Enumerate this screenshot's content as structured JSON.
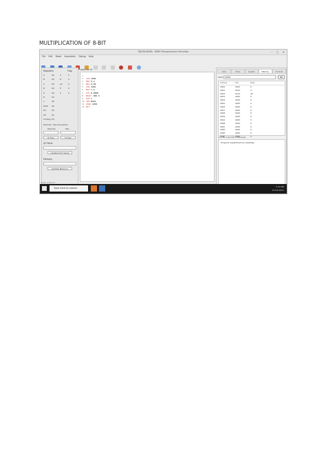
{
  "document": {
    "title": "MULTIPLICATION OF 8-BIT"
  },
  "window": {
    "title": "GNUSim8085 - 8085 Microprocessor Simulator"
  },
  "menu": [
    "File",
    "Edit",
    "Reset",
    "Assembler",
    "Debug",
    "Help"
  ],
  "registers": {
    "header_left": "Registers",
    "header_right": "Flag",
    "rows": [
      [
        "A",
        "00",
        "S",
        "0"
      ],
      [
        "B",
        "00",
        "Z",
        "0"
      ],
      [
        "C",
        "00",
        "AC",
        "0"
      ],
      [
        "D",
        "00",
        "P",
        "0"
      ],
      [
        "E",
        "00",
        "C",
        "0"
      ],
      [
        "H",
        "00",
        "",
        ""
      ],
      [
        "L",
        "00",
        "",
        ""
      ],
      [
        "PSW",
        "00",
        "",
        ""
      ],
      [
        "PC",
        "00",
        "",
        ""
      ],
      [
        "SP",
        "00",
        "",
        ""
      ],
      [
        "Int-Reg",
        "00",
        "",
        ""
      ]
    ]
  },
  "io_panel": {
    "header": "I/O Ports",
    "button": "Update Port Value"
  },
  "memory_panel": {
    "header": "Memory",
    "button": "Update Memory"
  },
  "decimal_panel": {
    "header": "Decimal - Hex Convertion",
    "left": "Decimal",
    "right": "Hex",
    "btn_left": "To Hex",
    "btn_right": "To Dec"
  },
  "editor": {
    "label": "Load me at",
    "lines": [
      {
        "n": "1",
        "op": "",
        "text": ""
      },
      {
        "n": "2",
        "op": "LDA",
        "text": " 2200"
      },
      {
        "n": "3",
        "op": "MOV",
        "text": " E,A"
      },
      {
        "n": "4",
        "op": "MVI",
        "text": " D,00"
      },
      {
        "n": "5",
        "op": "LDA",
        "text": " 2201"
      },
      {
        "n": "6",
        "op": "MOV",
        "text": " C,A"
      },
      {
        "n": "7",
        "op": "LXI",
        "text": " H,0000"
      },
      {
        "n": "8",
        "op": "BACK:",
        "text": " DAD D"
      },
      {
        "n": "9",
        "op": "DCR",
        "text": " C"
      },
      {
        "n": "10",
        "op": "JNZ",
        "text": " BACK"
      },
      {
        "n": "11",
        "op": "SHLD",
        "text": " 2202"
      },
      {
        "n": "12",
        "op": "HLT",
        "text": ""
      }
    ]
  },
  "tabs": [
    "Data",
    "Stack",
    "KeyPad",
    "Memory",
    "I/O Ports"
  ],
  "memory_view": {
    "addr_label": "Start",
    "addr_value": "2200",
    "ok": "OK",
    "columns": [
      "Address",
      "Hex",
      "Data"
    ],
    "rows": [
      [
        "2200",
        "0x05",
        "5"
      ],
      [
        "2201",
        "0x04",
        "4"
      ],
      [
        "2202",
        "0x14",
        "20"
      ],
      [
        "2203",
        "0x00",
        "0"
      ],
      [
        "2204",
        "0x00",
        "0"
      ],
      [
        "2205",
        "0x00",
        "0"
      ],
      [
        "2206",
        "0x00",
        "0"
      ],
      [
        "2207",
        "0x00",
        "0"
      ],
      [
        "2208",
        "0x00",
        "0"
      ],
      [
        "2209",
        "0x00",
        "0"
      ],
      [
        "220A",
        "0x00",
        "0"
      ],
      [
        "220B",
        "0x00",
        "0"
      ],
      [
        "220C",
        "0x00",
        "0"
      ],
      [
        "220D",
        "0x00",
        "0"
      ],
      [
        "220E",
        "0x00",
        "0"
      ],
      [
        "220F",
        "0x00",
        "0"
      ]
    ]
  },
  "messages": {
    "header": "Line No  Assembler Messages",
    "text": "Program assembled successfully"
  },
  "status": "Line: 1  Col: 0",
  "taskbar": {
    "search": "Type here to search",
    "time": "3:19 PM",
    "date": "21-04-2021"
  }
}
